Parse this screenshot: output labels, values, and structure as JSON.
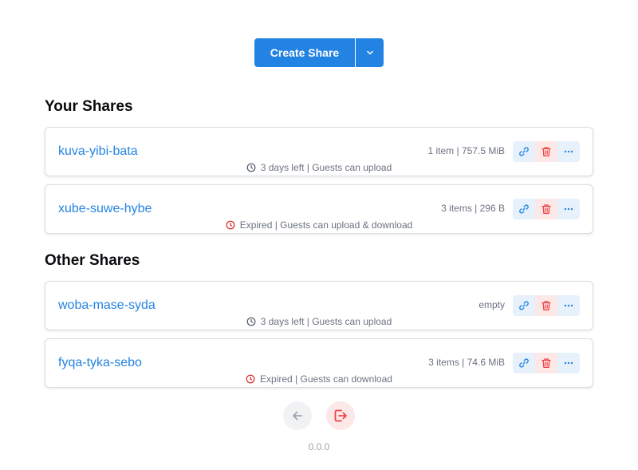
{
  "create_share": {
    "label": "Create Share"
  },
  "sections": {
    "your_shares": {
      "title": "Your Shares",
      "items": [
        {
          "name": "kuva-yibi-bata",
          "meta": "1 item | 757.5 MiB",
          "status": "3 days left | Guests can upload",
          "status_type": "active"
        },
        {
          "name": "xube-suwe-hybe",
          "meta": "3 items | 296 B",
          "status": "Expired | Guests can upload & download",
          "status_type": "expired"
        }
      ]
    },
    "other_shares": {
      "title": "Other Shares",
      "items": [
        {
          "name": "woba-mase-syda",
          "meta": "empty",
          "status": "3 days left | Guests can upload",
          "status_type": "active"
        },
        {
          "name": "fyqa-tyka-sebo",
          "meta": "3 items | 74.6 MiB",
          "status": "Expired | Guests can download",
          "status_type": "expired"
        }
      ]
    }
  },
  "footer": {
    "version": "0.0.0"
  },
  "colors": {
    "accent": "#2383e2",
    "danger": "#ef4444",
    "muted": "#6b7280"
  }
}
